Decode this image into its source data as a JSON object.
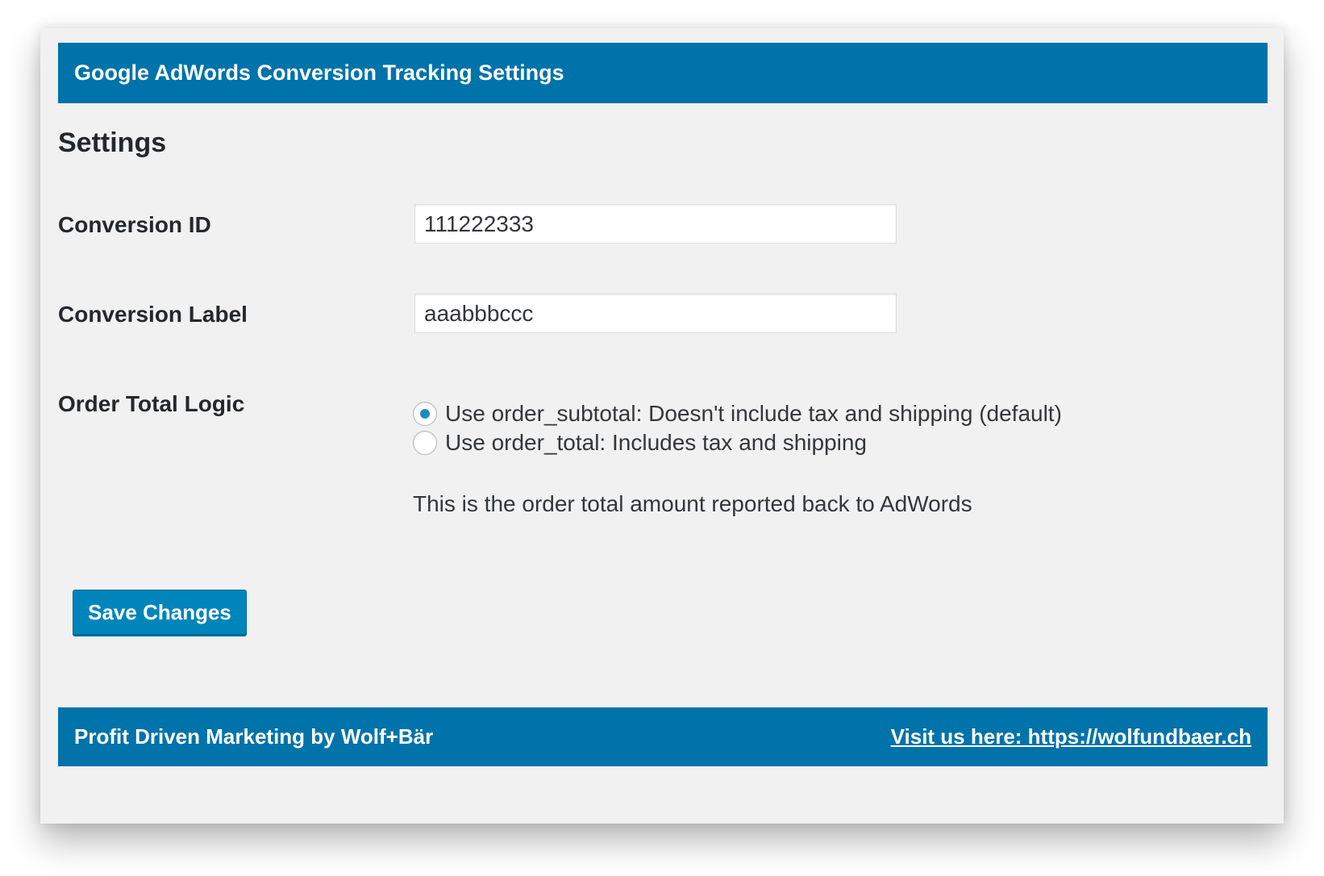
{
  "header": {
    "title": "Google AdWords Conversion Tracking Settings"
  },
  "section": {
    "title": "Settings"
  },
  "fields": {
    "conversion_id": {
      "label": "Conversion ID",
      "value": "111222333"
    },
    "conversion_label": {
      "label": "Conversion Label",
      "value": "aaabbbccc"
    },
    "order_total_logic": {
      "label": "Order Total Logic",
      "options": [
        {
          "label": "Use order_subtotal: Doesn't include tax and shipping (default)",
          "selected": true
        },
        {
          "label": "Use order_total: Includes tax and shipping",
          "selected": false
        }
      ],
      "help": "This is the order total amount reported back to AdWords"
    }
  },
  "actions": {
    "save_label": "Save Changes"
  },
  "footer": {
    "text": "Profit Driven Marketing by Wolf+Bär",
    "link_text": "Visit us here: https://wolfundbaer.ch"
  },
  "colors": {
    "brand_blue": "#0073aa",
    "button_blue": "#0085ba",
    "radio_checked": "#1e8cbe",
    "background": "#f1f1f1"
  }
}
